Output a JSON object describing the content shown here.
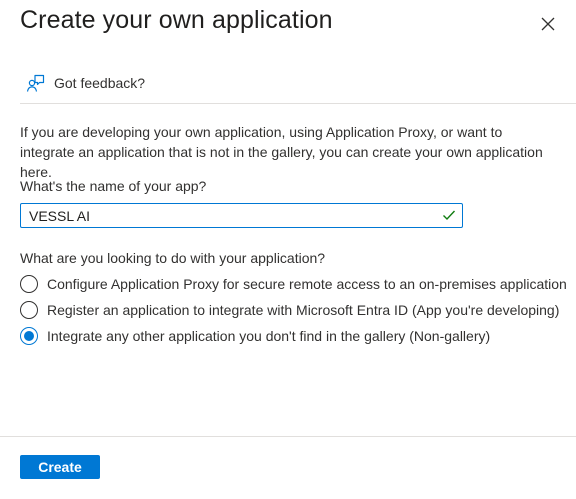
{
  "dialog": {
    "title": "Create your own application",
    "close_icon": "close-icon"
  },
  "feedback": {
    "label": "Got feedback?",
    "icon": "feedback-person-icon"
  },
  "intro_text": "If you are developing your own application, using Application Proxy, or want to integrate an application that is not in the gallery, you can create your own application here.",
  "app_name": {
    "label": "What's the name of your app?",
    "value": "VESSL AI",
    "valid_icon": "checkmark-icon"
  },
  "purpose": {
    "question": "What are you looking to do with your application?",
    "options": [
      {
        "label": "Configure Application Proxy for secure remote access to an on-premises application",
        "selected": false
      },
      {
        "label": "Register an application to integrate with Microsoft Entra ID (App you're developing)",
        "selected": false
      },
      {
        "label": "Integrate any other application you don't find in the gallery (Non-gallery)",
        "selected": true
      }
    ]
  },
  "footer": {
    "create_label": "Create"
  },
  "colors": {
    "accent": "#0078d4",
    "valid": "#107c10",
    "text": "#323130"
  }
}
